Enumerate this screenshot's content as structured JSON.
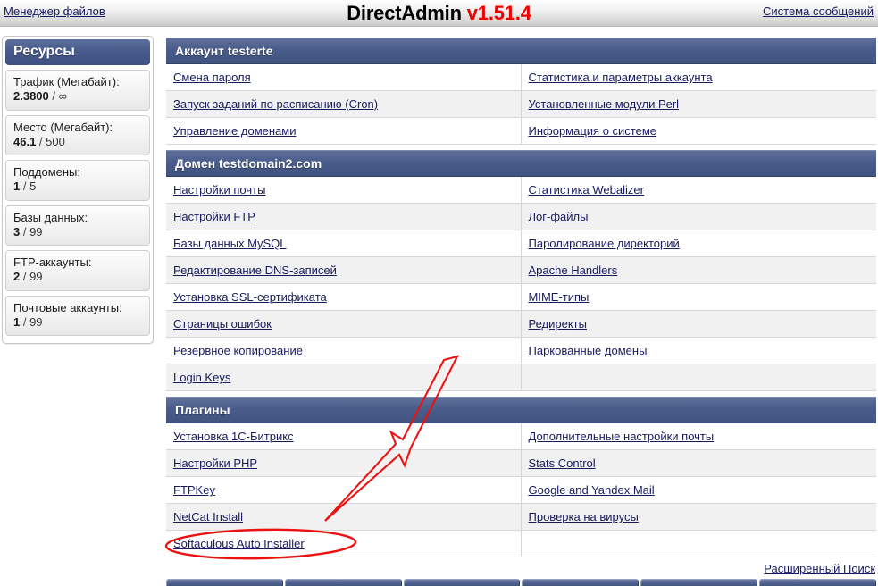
{
  "topbar": {
    "left_link": "Менеджер файлов",
    "title_main": "DirectAdmin",
    "title_version": "v1.51.4",
    "right_link": "Система сообщений"
  },
  "sidebar": {
    "header": "Ресурсы",
    "resources": [
      {
        "label": "Трафик (Мегабайт):",
        "used": "2.3800",
        "sep": "/",
        "max": "∞"
      },
      {
        "label": "Место (Мегабайт):",
        "used": "46.1",
        "sep": "/",
        "max": "500"
      },
      {
        "label": "Поддомены:",
        "used": "1",
        "sep": "/",
        "max": "5"
      },
      {
        "label": "Базы данных:",
        "used": "3",
        "sep": "/",
        "max": "99"
      },
      {
        "label": "FTP-аккаунты:",
        "used": "2",
        "sep": "/",
        "max": "99"
      },
      {
        "label": "Почтовые аккаунты:",
        "used": "1",
        "sep": "/",
        "max": "99"
      }
    ]
  },
  "sections": [
    {
      "header": "Аккаунт testerte",
      "rows": [
        {
          "left": "Смена пароля",
          "right": "Статистика и параметры аккаунта"
        },
        {
          "left": "Запуск заданий по расписанию (Cron)",
          "right": "Установленные модули Perl"
        },
        {
          "left": "Управление доменами",
          "right": "Информация о системе"
        }
      ]
    },
    {
      "header": "Домен testdomain2.com",
      "rows": [
        {
          "left": "Настройки почты",
          "right": "Статистика Webalizer"
        },
        {
          "left": "Настройки FTP",
          "right": "Лог-файлы"
        },
        {
          "left": "Базы данных MySQL",
          "right": "Паролирование директорий"
        },
        {
          "left": "Редактирование DNS-записей",
          "right": "Apache Handlers"
        },
        {
          "left": "Установка SSL-сертификата",
          "right": "MIME-типы"
        },
        {
          "left": "Страницы ошибок",
          "right": "Редиректы"
        },
        {
          "left": "Резервное копирование",
          "right": "Паркованные домены"
        },
        {
          "left": "Login Keys",
          "right": ""
        }
      ]
    },
    {
      "header": "Плагины",
      "rows": [
        {
          "left": "Установка 1С-Битрикс",
          "right": "Дополнительные настройки почты"
        },
        {
          "left": "Настройки PHP",
          "right": "Stats Control"
        },
        {
          "left": "FTPKey",
          "right": "Google and Yandex Mail"
        },
        {
          "left": "NetCat Install",
          "right": "Проверка на вирусы"
        },
        {
          "left": "Softaculous Auto Installer",
          "right": ""
        }
      ]
    }
  ],
  "footer": {
    "advanced_search": "Расширенный Поиск",
    "tab_count": 6
  },
  "annotations": {
    "highlight_color": "#ee1111",
    "arrow_target": "Softaculous Auto Installer",
    "ellipse_target": "Softaculous Auto Installer"
  }
}
